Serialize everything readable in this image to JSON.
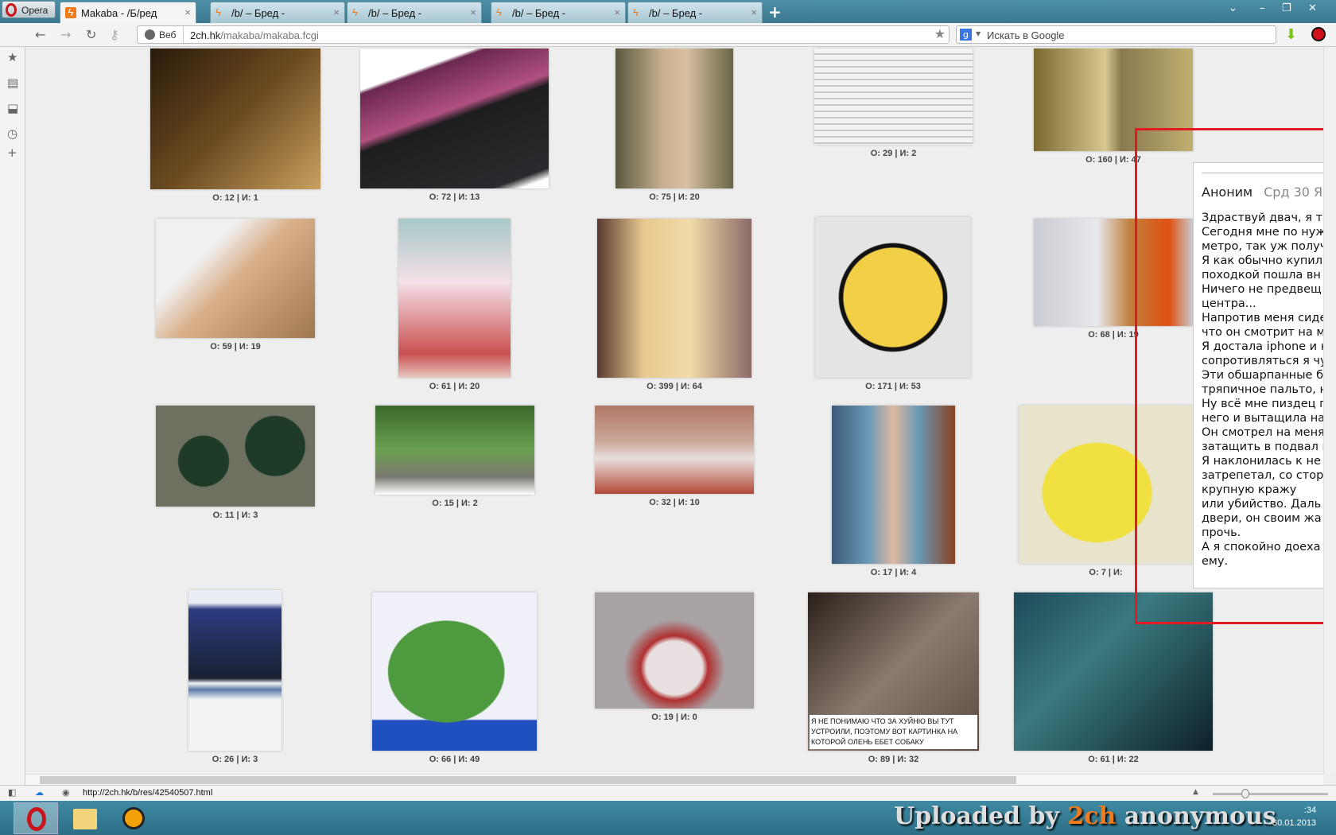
{
  "browser": {
    "menu_label": "Opera",
    "tabs": [
      {
        "label": "Makaba - /Б/ред",
        "active": true
      },
      {
        "label": "/b/ – Бред -"
      },
      {
        "label": "/b/ – Бред -"
      },
      {
        "label": "/b/ – Бред -"
      },
      {
        "label": "/b/ – Бред -"
      }
    ],
    "address": {
      "scheme_label": "Веб",
      "host": "2ch.hk",
      "path": "/makaba/makaba.fcgi"
    },
    "search_placeholder": "Искать в Google"
  },
  "thumbs": [
    {
      "caption": "О: 12 | И: 1",
      "color": "#6b4a20"
    },
    {
      "caption": "О: 72 | И: 13",
      "color": "#2a2a2e"
    },
    {
      "caption": "О: 75 | И: 20",
      "color": "#8c8460"
    },
    {
      "caption": "О: 29 | И: 2",
      "color": "#e4e4e4"
    },
    {
      "caption": "О: 160 | И: 47",
      "color": "#b8a560"
    },
    {
      "caption": "О: 59 | И: 19",
      "color": "#b99c7c"
    },
    {
      "caption": "О: 61 | И: 20",
      "color": "#d8c8d0"
    },
    {
      "caption": "О: 399 | И: 64",
      "color": "#d9b887"
    },
    {
      "caption": "О: 171 | И: 53",
      "color": "#f2cf46"
    },
    {
      "caption": "О: 68 | И: 19",
      "color": "#c9ccd2"
    },
    {
      "caption": "О: 11 | И: 3",
      "color": "#5e6350"
    },
    {
      "caption": "О: 15 | И: 2",
      "color": "#4c7a3c"
    },
    {
      "caption": "О: 32 | И: 10",
      "color": "#a06a58"
    },
    {
      "caption": "О: 17 | И: 4",
      "color": "#6a9ab8"
    },
    {
      "caption": "О: 7 | И:",
      "color": "#f0e040"
    },
    {
      "caption": "О: 26 | И: 3",
      "color": "#2c3c80"
    },
    {
      "caption": "О: 66 | И: 49",
      "color": "#4e9a3e"
    },
    {
      "caption": "О: 19 | И: 0",
      "color": "#a9a2a5"
    },
    {
      "caption": "О: 89 | И: 32",
      "color": "#7a6a60",
      "text": "Я НЕ ПОНИМАЮ ЧТО ЗА ХУЙНЮ ВЫ ТУТ УСТРОИЛИ, ПОЭТОМУ ВОТ КАРТИНКА НА КОТОРОЙ ОЛЕНЬ ЕБЕТ СОБАКУ"
    },
    {
      "caption": "О: 61 | И: 22",
      "color": "#1e4a58"
    }
  ],
  "popup": {
    "name": "Аноним",
    "date": "Срд 30 Я",
    "body": "Здраствуй двач, я тя\nСегодня мне по нуж\nметро, так уж получ\nЯ как обычно купил\nпоходкой пошла вн\nНичего не предвещ\nцентра...\nНапротив меня сиде\nчто он смотрит на м\nЯ достала iphone и н\nсопротивляться я чу\nЭти обшарпанные б\nтряпичное пальто, н\nНу всё мне пиздец п\nнего и вытащила на\nОн смотрел на меня\nзатащить в подвал и\nЯ наклонилась к не\nзатрепетал, со стор\nкрупную кражу\nили убийство. Даль\nдвери, он своим жа\nпрочь.\nА я спокойно доеха\nему."
  },
  "status": {
    "url": "http://2ch.hk/b/res/42540507.html"
  },
  "taskbar": {
    "watermark_pre": "Uploaded by ",
    "watermark_brand": "2ch",
    "watermark_post": " anonymous",
    "time": ":34",
    "date": "30.01.2013"
  }
}
